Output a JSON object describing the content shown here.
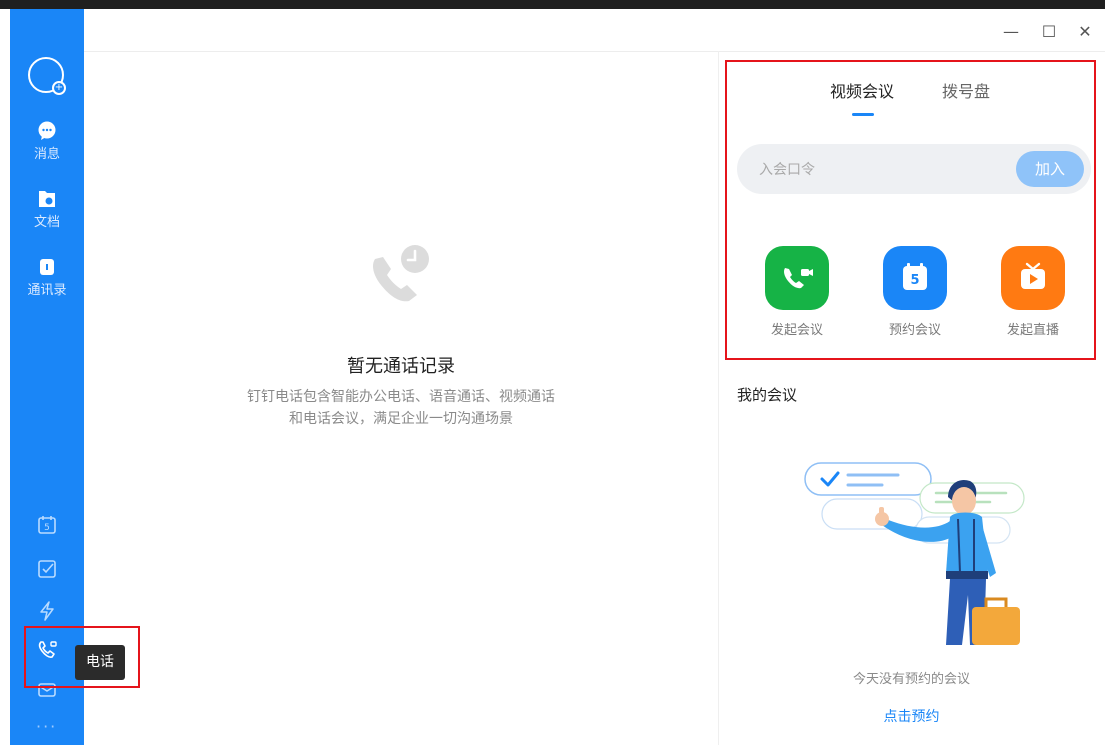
{
  "window": {
    "min": "—",
    "max": "☐",
    "close": "✕"
  },
  "sidebar": {
    "items": [
      {
        "label": "消息",
        "icon": "message-icon"
      },
      {
        "label": "文档",
        "icon": "document-icon"
      },
      {
        "label": "通讯录",
        "icon": "contacts-icon"
      }
    ],
    "bottom_icons": [
      "calendar-icon",
      "todo-icon",
      "ding-icon",
      "phone-icon",
      "mail-icon"
    ],
    "calendar_day": "5",
    "more": "···",
    "tooltip": "电话"
  },
  "middle": {
    "empty_title": "暂无通话记录",
    "empty_desc_line1": "钉钉电话包含智能办公电话、语音通话、视频通话",
    "empty_desc_line2": "和电话会议，满足企业一切沟通场景"
  },
  "right": {
    "tabs": [
      {
        "label": "视频会议",
        "active": true
      },
      {
        "label": "拨号盘",
        "active": false
      }
    ],
    "join": {
      "placeholder": "入会口令",
      "button": "加入"
    },
    "actions": [
      {
        "label": "发起会议",
        "color": "#16b346",
        "icon": "video-call-icon"
      },
      {
        "label": "预约会议",
        "color": "#1a86f7",
        "icon": "calendar-icon",
        "badge": "5"
      },
      {
        "label": "发起直播",
        "color": "#ff7a12",
        "icon": "live-icon"
      }
    ],
    "my_meetings_title": "我的会议",
    "no_meeting": "今天没有预约的会议",
    "book_link": "点击预约"
  },
  "colors": {
    "accent": "#1a86f7",
    "sidebar": "#1a86f7",
    "highlight": "#e5141b"
  }
}
